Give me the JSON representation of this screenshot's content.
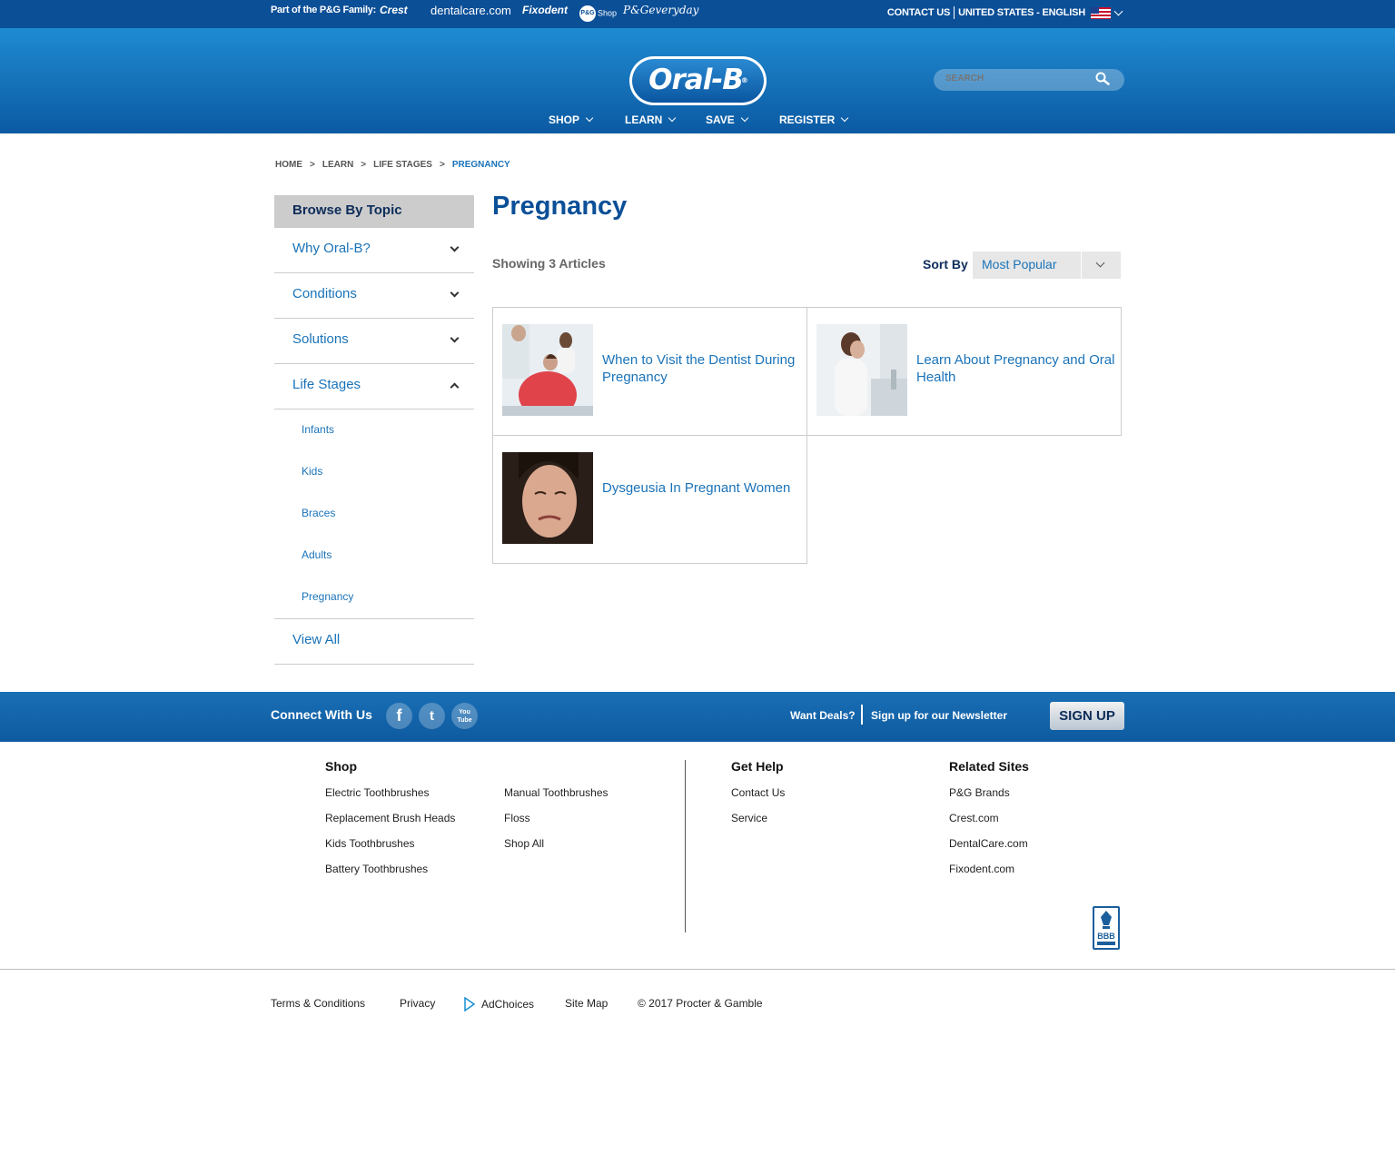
{
  "family_bar": {
    "label": "Part of the P&G Family:",
    "brands": [
      "Crest",
      "dentalcare.com",
      "Fixodent",
      "P&G",
      "Shop",
      "P&Geveryday"
    ],
    "contact": "CONTACT US",
    "locale": "UNITED STATES - ENGLISH"
  },
  "header": {
    "logo": "Oral-B",
    "logo_mark": "®",
    "search_placeholder": "SEARCH",
    "nav": [
      "SHOP",
      "LEARN",
      "SAVE",
      "REGISTER"
    ]
  },
  "breadcrumb": [
    "HOME",
    ">",
    "LEARN",
    ">",
    "LIFE STAGES",
    ">",
    "PREGNANCY"
  ],
  "sidebar": {
    "head": "Browse By Topic",
    "items": [
      "Why Oral-B?",
      "Conditions",
      "Solutions",
      "Life Stages"
    ],
    "sub_items": [
      "Infants",
      "Kids",
      "Braces",
      "Adults",
      "Pregnancy"
    ],
    "view_all": "View All"
  },
  "main": {
    "title": "Pregnancy",
    "count": "Showing 3 Articles",
    "sort_label": "Sort By",
    "sort_value": "Most Popular",
    "articles": [
      {
        "title": "When to Visit the Dentist During Pregnancy"
      },
      {
        "title": "Learn About Pregnancy and Oral Health"
      },
      {
        "title": "Dysgeusia In Pregnant Women"
      }
    ]
  },
  "connect": {
    "label": "Connect With Us",
    "social": [
      "f",
      "t",
      "You Tube"
    ],
    "want": "Want Deals?",
    "newsletter": "Sign up for our Newsletter",
    "signup": "SIGN UP"
  },
  "footer": {
    "shop_head": "Shop",
    "shop_col1": [
      "Electric Toothbrushes",
      "Replacement Brush Heads",
      "Kids Toothbrushes",
      "Battery Toothbrushes"
    ],
    "shop_col2": [
      "Manual Toothbrushes",
      "Floss",
      "Shop All"
    ],
    "help_head": "Get Help",
    "help_links": [
      "Contact Us",
      "Service"
    ],
    "related_head": "Related Sites",
    "related_links": [
      "P&G Brands",
      "Crest.com",
      "DentalCare.com",
      "Fixodent.com"
    ],
    "bbb": "BBB",
    "bottom_links": [
      "Terms & Conditions",
      "Privacy",
      "AdChoices",
      "Site Map",
      "© 2017 Procter & Gamble"
    ]
  },
  "colors": {
    "brand_blue": "#0b4f97",
    "link_blue": "#1a73b9",
    "header_blue": "#1775bc"
  }
}
